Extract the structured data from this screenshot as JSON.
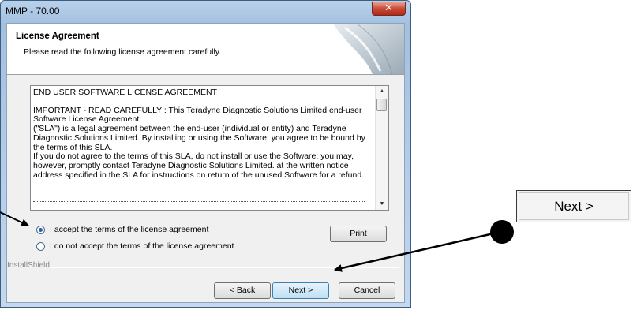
{
  "window": {
    "title": "MMP - 70.00"
  },
  "header": {
    "title": "License Agreement",
    "subtitle": "Please read the following license agreement carefully."
  },
  "license": {
    "heading": "END USER SOFTWARE LICENSE AGREEMENT",
    "lines": [
      "IMPORTANT - READ CAREFULLY : This Teradyne Diagnostic Solutions Limited end-user",
      "Software License Agreement",
      "(\"SLA\") is a legal agreement between the end-user (individual or entity) and Teradyne",
      "Diagnostic Solutions Limited. By installing or using the Software, you agree to be bound by",
      "the terms of this SLA.",
      "If you do not agree to the terms of this SLA, do not install or use the Software; you may,",
      "however, promptly contact Teradyne Diagnostic Solutions Limited. at the written notice",
      "address specified in the SLA for instructions on return of the unused Software for a refund."
    ]
  },
  "options": {
    "accept_label": "I accept the terms of the license agreement",
    "decline_label": "I do not accept the terms of the license agreement",
    "selected": "accept"
  },
  "buttons": {
    "print": "Print",
    "back": "< Back",
    "next": "Next >",
    "cancel": "Cancel"
  },
  "footer": {
    "brand": "InstallShield"
  },
  "callout": {
    "next_label": "Next >"
  },
  "colors": {
    "accent": "#3c7fb1",
    "close": "#c74a36"
  }
}
